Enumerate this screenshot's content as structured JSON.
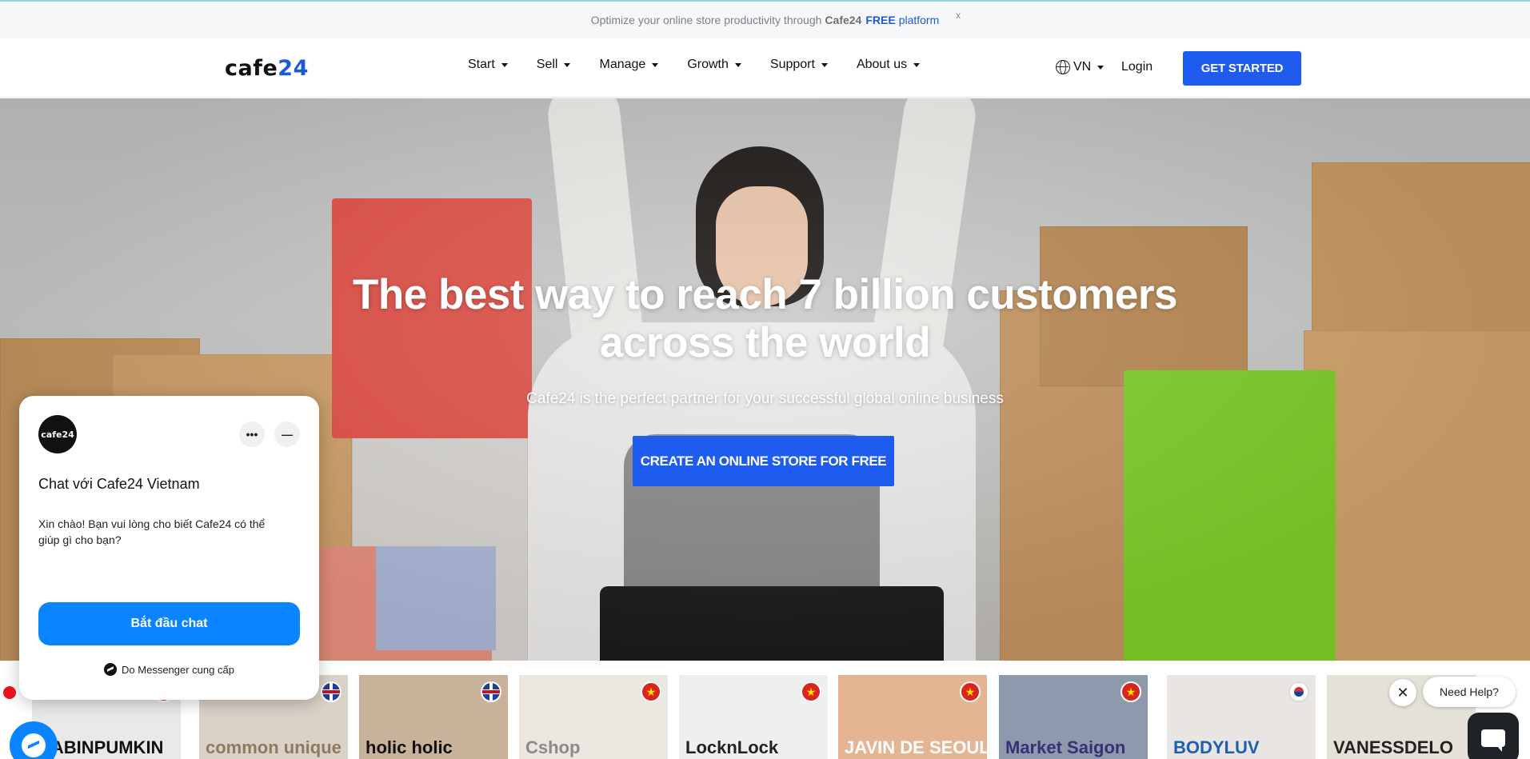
{
  "promo": {
    "text_prefix": "Optimize your online store productivity through",
    "brand": "Cafe24",
    "free": "FREE",
    "platform": "platform",
    "close": "x"
  },
  "header": {
    "logo_a": "cafe",
    "logo_b": "24",
    "nav": [
      {
        "label": "Start"
      },
      {
        "label": "Sell"
      },
      {
        "label": "Manage"
      },
      {
        "label": "Growth"
      },
      {
        "label": "Support"
      },
      {
        "label": "About us"
      }
    ],
    "lang": "VN",
    "login": "Login",
    "cta": "GET STARTED"
  },
  "hero": {
    "title_line1": "The best way to reach 7 billion customers",
    "title_line2": "across the world",
    "subtitle": "Cafe24 is the perfect partner for your successful global online business",
    "cta": "CREATE AN ONLINE STORE FOR FREE"
  },
  "stores": [
    {
      "label": "BABINPUMKIN",
      "flag": "vn",
      "bg": "#e9e9ea",
      "color": "#111"
    },
    {
      "label": "common unique",
      "flag": "uk",
      "bg": "#d9d2c8",
      "color": "#8f7a60"
    },
    {
      "label": "holic holic",
      "flag": "uk",
      "bg": "#c9b29a",
      "color": "#111"
    },
    {
      "label": "Cshop",
      "flag": "vn",
      "bg": "#ebe6e0",
      "color": "#8a8a8a"
    },
    {
      "label": "LocknLock",
      "flag": "vn",
      "bg": "#eef0ee",
      "color": "#222"
    },
    {
      "label": "JAVIN DE SEOUL",
      "flag": "vn",
      "bg": "#e4b493",
      "color": "#fff"
    },
    {
      "label": "Market Saigon",
      "flag": "vn",
      "bg": "#8e9aab",
      "color": "#3a2f7a"
    },
    {
      "label": "BODYLUV",
      "flag": "kr",
      "bg": "#e8e5e2",
      "color": "#1c5fb5"
    },
    {
      "label": "VANESSDELO",
      "flag": "vn",
      "bg": "#e6e1d8",
      "color": "#222"
    }
  ],
  "chat": {
    "avatar_text": "cafe24",
    "more": "•••",
    "minimize": "—",
    "title": "Chat với Cafe24 Vietnam",
    "message": "Xin chào! Bạn vui lòng cho biết Cafe24 có thể giúp gì cho bạn?",
    "start": "Bắt đầu chat",
    "footer": "Do Messenger cung cấp"
  },
  "help": {
    "close": "✕",
    "label": "Need Help?"
  },
  "colors": {
    "accent": "#1e5cf0",
    "messenger": "#0a84ff"
  }
}
